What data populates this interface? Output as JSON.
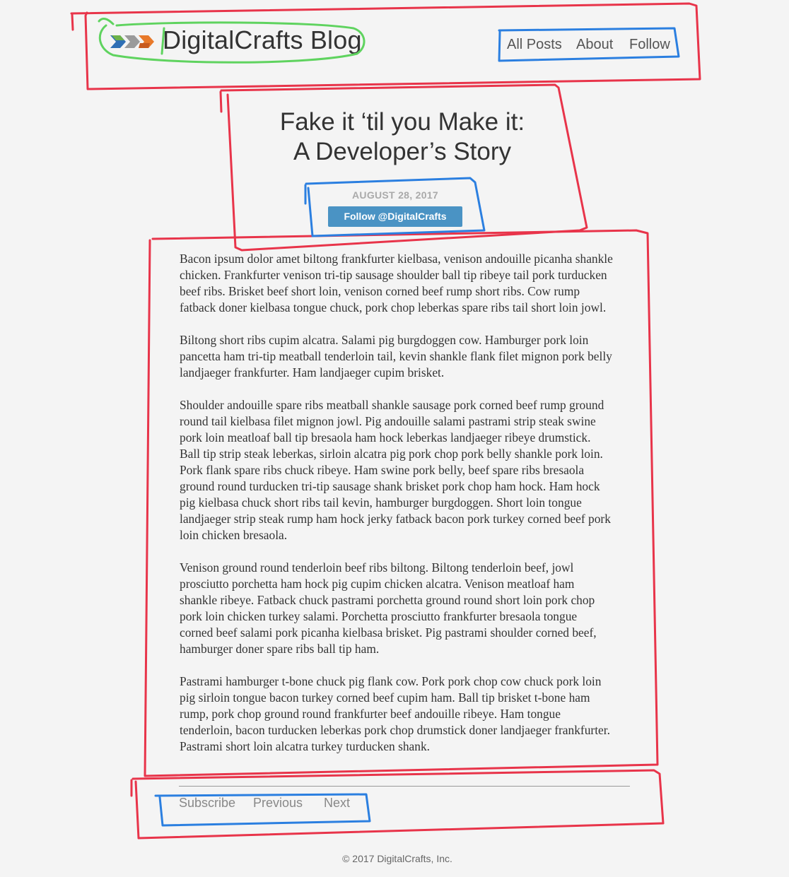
{
  "header": {
    "brand": "DigitalCrafts Blog",
    "logo_icon": "digitalcrafts-logo-icon",
    "nav": [
      "All Posts",
      "About",
      "Follow"
    ]
  },
  "post": {
    "title_line1": "Fake it ‘til you Make it:",
    "title_line2": "A Developer’s Story",
    "date": "AUGUST 28, 2017",
    "follow_button": "Follow @DigitalCrafts",
    "paragraphs": [
      [
        "Bacon ipsum dolor amet biltong frankfurter kielbasa, venison andouille picanha shankle",
        "chicken. Frankfurter venison tri-tip sausage shoulder ball tip ribeye tail pork turducken",
        "beef ribs. Brisket beef short loin, venison corned beef rump short ribs. Cow rump",
        "fatback doner kielbasa tongue chuck, pork chop leberkas spare ribs tail short loin jowl."
      ],
      [
        "Biltong short ribs cupim alcatra. Salami pig burgdoggen cow. Hamburger pork loin",
        "pancetta ham tri-tip meatball tenderloin tail, kevin shankle flank filet mignon pork belly",
        "landjaeger frankfurter. Ham landjaeger cupim brisket."
      ],
      [
        "Shoulder andouille spare ribs meatball shankle sausage pork corned beef rump ground",
        "round tail kielbasa filet mignon jowl. Pig andouille salami pastrami strip steak swine",
        "pork loin meatloaf ball tip bresaola ham hock leberkas landjaeger ribeye drumstick.",
        "Ball tip strip steak leberkas, sirloin alcatra pig pork chop pork belly shankle pork loin.",
        "Pork flank spare ribs chuck ribeye. Ham swine pork belly, beef spare ribs bresaola",
        "ground round turducken tri-tip sausage shank brisket pork chop ham hock. Ham hock",
        "pig kielbasa chuck short ribs tail kevin, hamburger burgdoggen. Short loin tongue",
        "landjaeger strip steak rump ham hock jerky fatback bacon pork turkey corned beef pork",
        "loin chicken bresaola."
      ],
      [
        "Venison ground round tenderloin beef ribs biltong. Biltong tenderloin beef, jowl",
        "prosciutto porchetta ham hock pig cupim chicken alcatra. Venison meatloaf ham",
        "shankle ribeye. Fatback chuck pastrami porchetta ground round short loin pork chop",
        "pork loin chicken turkey salami. Porchetta prosciutto frankfurter bresaola tongue",
        "corned beef salami pork picanha kielbasa brisket. Pig pastrami shoulder corned beef,",
        "hamburger doner spare ribs ball tip ham."
      ],
      [
        "Pastrami hamburger t-bone chuck pig flank cow. Pork pork chop cow chuck pork loin",
        "pig sirloin tongue bacon turkey corned beef cupim ham. Ball tip brisket t-bone ham",
        "rump, pork chop ground round frankfurter beef andouille ribeye. Ham tongue",
        "tenderloin, bacon turducken leberkas pork chop drumstick doner landjaeger frankfurter.",
        "Pastrami short loin alcatra turkey turducken shank."
      ]
    ]
  },
  "footer": {
    "nav": [
      "Subscribe",
      "Previous",
      "Next"
    ],
    "copyright": "© 2017 DigitalCrafts, Inc."
  },
  "colors": {
    "background": "#f4f4f4",
    "button": "#4a93c4",
    "annotation_red": "#e8344a",
    "annotation_blue": "#2b7fe0",
    "annotation_green": "#5fd35f"
  }
}
